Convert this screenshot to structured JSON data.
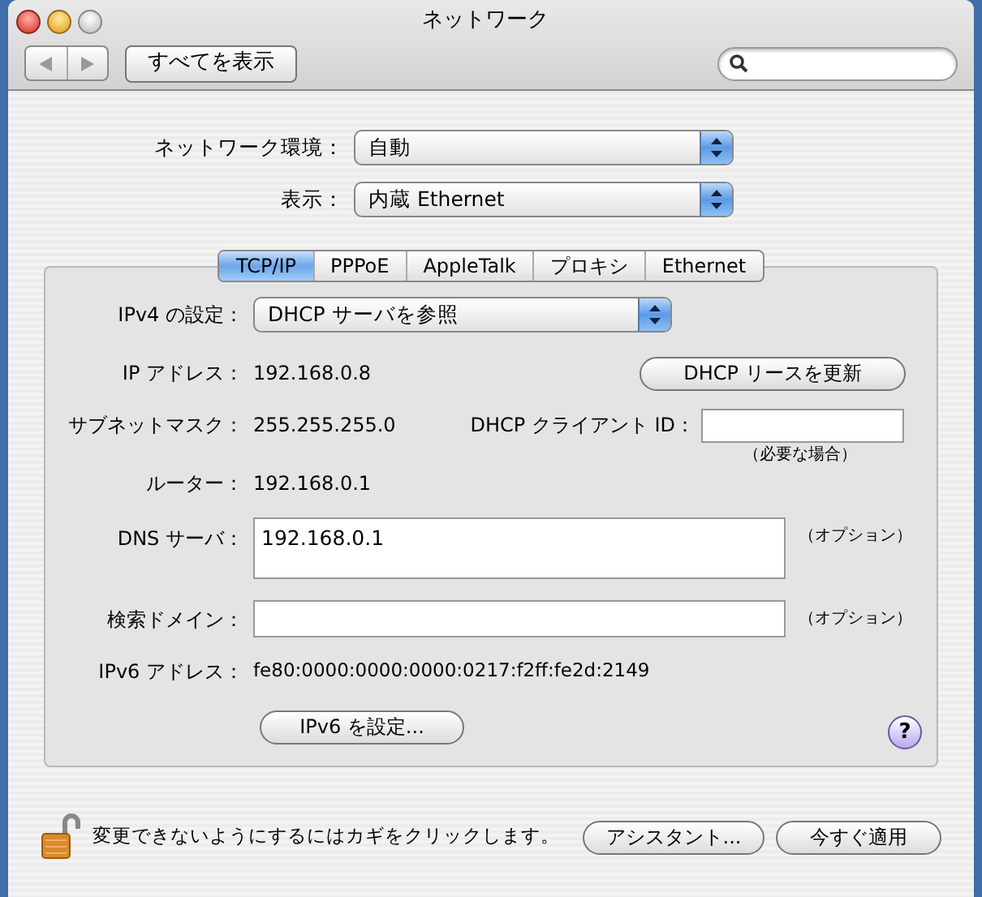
{
  "window": {
    "title": "ネットワーク"
  },
  "toolbar": {
    "show_all": "すべてを表示"
  },
  "location": {
    "label": "ネットワーク環境：",
    "value": "自動"
  },
  "show": {
    "label": "表示：",
    "value": "内蔵 Ethernet"
  },
  "tabs": [
    {
      "label": "TCP/IP",
      "selected": true
    },
    {
      "label": "PPPoE",
      "selected": false
    },
    {
      "label": "AppleTalk",
      "selected": false
    },
    {
      "label": "プロキシ",
      "selected": false
    },
    {
      "label": "Ethernet",
      "selected": false
    }
  ],
  "tcpip": {
    "ipv4_config": {
      "label": "IPv4 の設定：",
      "value": "DHCP サーバを参照"
    },
    "ip_address": {
      "label": "IP アドレス：",
      "value": "192.168.0.8"
    },
    "renew_button": "DHCP リースを更新",
    "subnet_mask": {
      "label": "サブネットマスク：",
      "value": "255.255.255.0"
    },
    "client_id": {
      "label": "DHCP クライアント ID：",
      "note": "（必要な場合）"
    },
    "router": {
      "label": "ルーター：",
      "value": "192.168.0.1"
    },
    "dns_servers": {
      "label": "DNS サーバ：",
      "value": "192.168.0.1",
      "note": "（オプション）"
    },
    "search_domains": {
      "label": "検索ドメイン：",
      "note": "（オプション）"
    },
    "ipv6_address": {
      "label": "IPv6 アドレス：",
      "value": "fe80:0000:0000:0000:0217:f2ff:fe2d:2149"
    },
    "ipv6_button": "IPv6 を設定...",
    "help": "?"
  },
  "footer": {
    "lock_text": "変更できないようにするにはカギをクリックします。",
    "buttons": [
      "アシスタント...",
      "今すぐ適用"
    ]
  }
}
